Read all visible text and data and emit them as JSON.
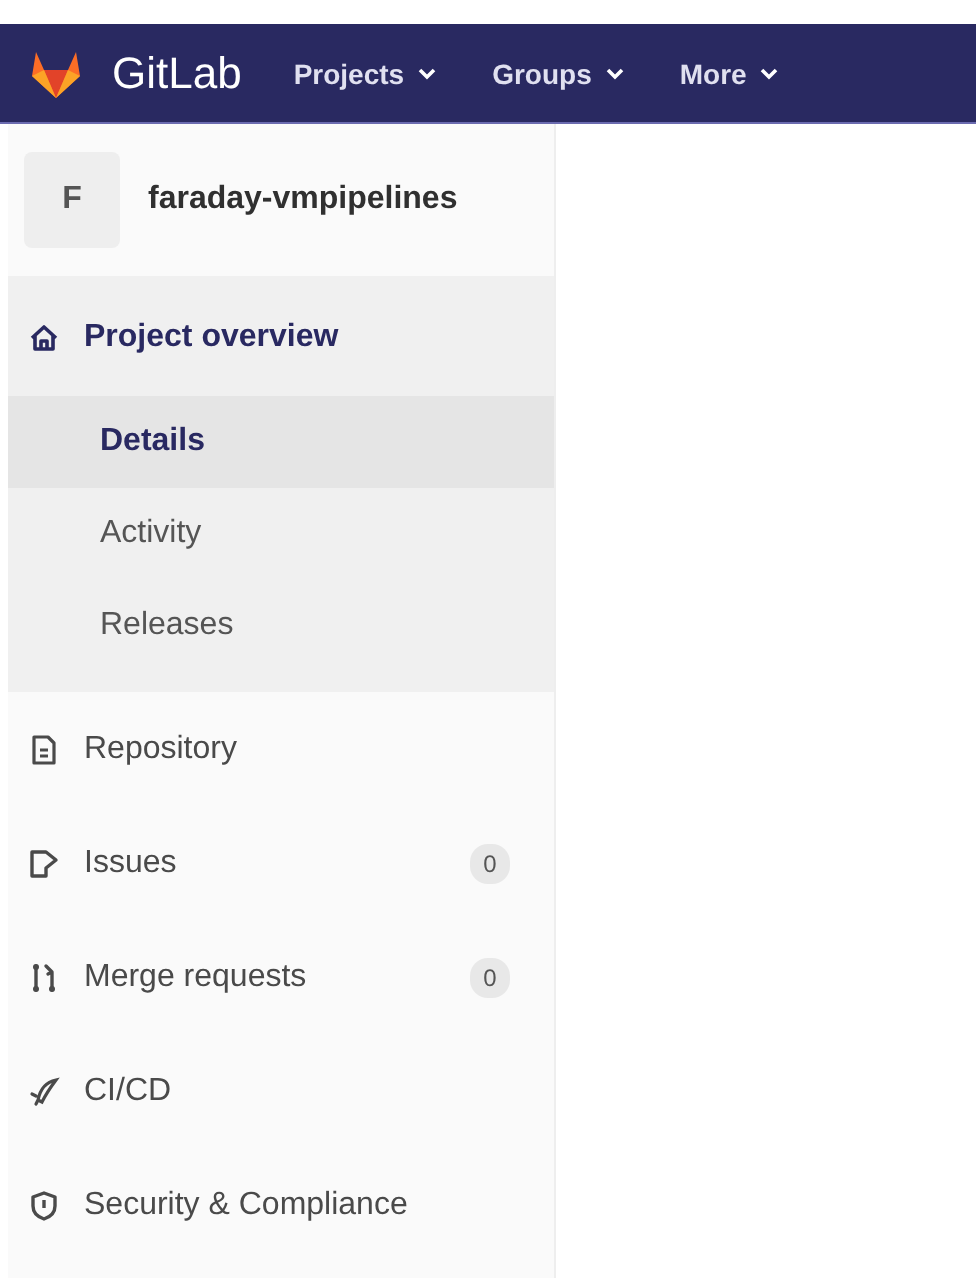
{
  "navbar": {
    "brand": "GitLab",
    "menus": [
      {
        "label": "Projects"
      },
      {
        "label": "Groups"
      },
      {
        "label": "More"
      }
    ]
  },
  "project": {
    "avatar": "F",
    "name": "faraday-vmpipelines"
  },
  "sidebar": {
    "items": [
      {
        "label": "Project overview",
        "selected": true,
        "children": [
          {
            "label": "Details",
            "selected": true
          },
          {
            "label": "Activity",
            "selected": false
          },
          {
            "label": "Releases",
            "selected": false
          }
        ]
      },
      {
        "label": "Repository",
        "selected": false
      },
      {
        "label": "Issues",
        "selected": false,
        "count": "0"
      },
      {
        "label": "Merge requests",
        "selected": false,
        "count": "0"
      },
      {
        "label": "CI/CD",
        "selected": false
      },
      {
        "label": "Security & Compliance",
        "selected": false
      }
    ]
  }
}
